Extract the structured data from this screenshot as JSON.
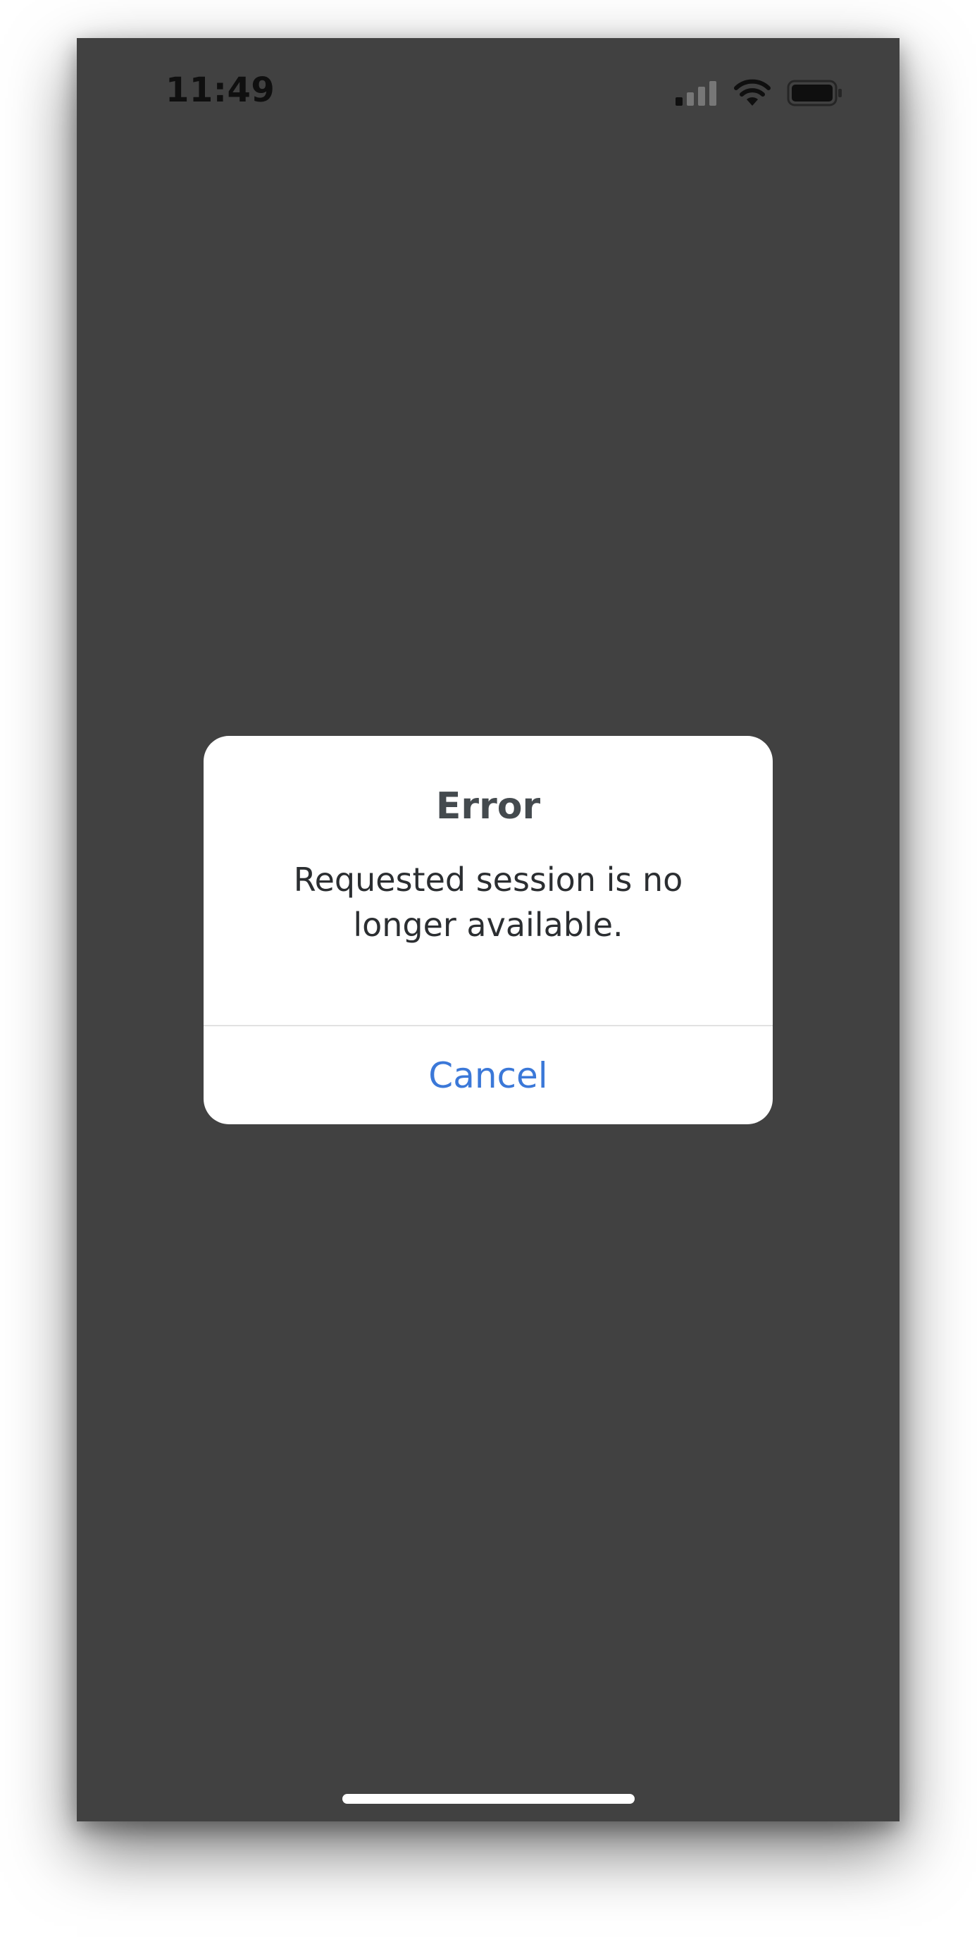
{
  "status_bar": {
    "time": "11:49",
    "icons": [
      "cellular-signal-icon",
      "wifi-icon",
      "battery-icon"
    ]
  },
  "alert": {
    "title": "Error",
    "message": "Requested session is no longer available.",
    "cancel_label": "Cancel"
  },
  "colors": {
    "background": "#414141",
    "alert_background": "#ffffff",
    "button_text": "#3b78d8",
    "title_text": "#444a4e",
    "message_text": "#2b2e31"
  }
}
